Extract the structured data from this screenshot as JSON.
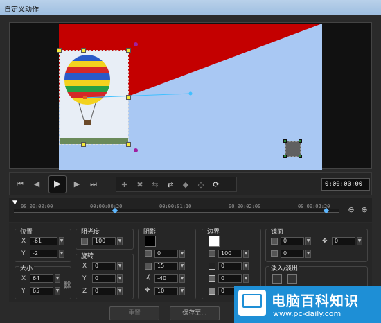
{
  "window": {
    "title": "自定义动作"
  },
  "transport": {
    "timecode": "0:00:00:00",
    "icons": [
      "go-start-icon",
      "step-back-icon",
      "play-icon",
      "step-forward-icon",
      "go-end-icon"
    ]
  },
  "timeline": {
    "labels": [
      "00:00:00:00",
      "00:00:00:20",
      "00:00:01:10",
      "00:00:02:00",
      "00:00:02:20"
    ]
  },
  "position": {
    "label": "位置",
    "x_label": "X",
    "x": "-61",
    "y_label": "Y",
    "y": "-2"
  },
  "size": {
    "label": "大小",
    "x_label": "X",
    "x": "64",
    "y_label": "Y",
    "y": "65"
  },
  "opacity": {
    "label": "阻光度",
    "value": "100"
  },
  "rotation": {
    "label": "旋转",
    "x_label": "X",
    "x": "0",
    "y_label": "Y",
    "y": "0",
    "z_label": "Z",
    "z": "0"
  },
  "shadow": {
    "label": "阴影",
    "color": "#000000",
    "v1": "0",
    "v2": "15",
    "v3": "-40",
    "v4": "10"
  },
  "border": {
    "label": "边界",
    "color": "#ffffff",
    "v1": "100",
    "v2": "0",
    "v3": "0",
    "v4": "0"
  },
  "mirror": {
    "label": "镜面",
    "v1": "0",
    "v2": "0",
    "move": "0"
  },
  "fade": {
    "label": "淡入/淡出"
  },
  "buttons": {
    "reset": "重置",
    "save_as": "保存至..."
  },
  "watermark": {
    "title": "电脑百科知识",
    "url": "www.pc-daily.com"
  },
  "colors": {
    "canvas_bg": "#a9c8f3",
    "red_shape": "#c40000",
    "accent": "#5fb8ff"
  }
}
